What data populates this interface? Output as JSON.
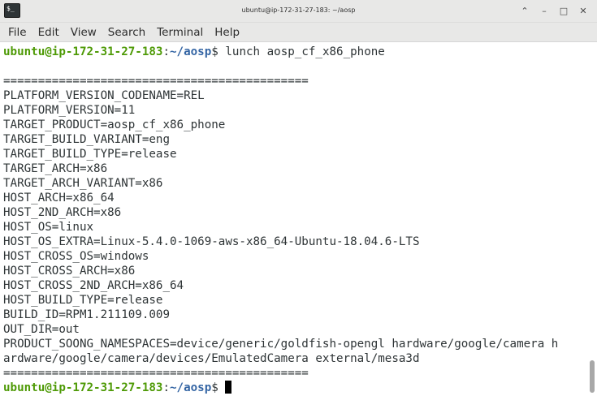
{
  "window": {
    "title": "ubuntu@ip-172-31-27-183: ~/aosp",
    "icon_glyph": "$_",
    "icons": {
      "app": "terminal-icon",
      "minimize": "chevron-up-icon",
      "minimize2": "minimize-icon",
      "maximize": "maximize-icon",
      "close": "close-icon"
    },
    "buttons": {
      "up": "⌃",
      "min": "–",
      "max": "□",
      "close": "✕"
    }
  },
  "menu": {
    "file": "File",
    "edit": "Edit",
    "view": "View",
    "search": "Search",
    "terminal": "Terminal",
    "help": "Help"
  },
  "terminal": {
    "prompt_user": "ubuntu@ip-172-31-27-183",
    "prompt_sep": ":",
    "prompt_path": "~/aosp",
    "prompt_symbol": "$ ",
    "command": "lunch aosp_cf_x86_phone",
    "output": [
      "",
      "============================================",
      "PLATFORM_VERSION_CODENAME=REL",
      "PLATFORM_VERSION=11",
      "TARGET_PRODUCT=aosp_cf_x86_phone",
      "TARGET_BUILD_VARIANT=eng",
      "TARGET_BUILD_TYPE=release",
      "TARGET_ARCH=x86",
      "TARGET_ARCH_VARIANT=x86",
      "HOST_ARCH=x86_64",
      "HOST_2ND_ARCH=x86",
      "HOST_OS=linux",
      "HOST_OS_EXTRA=Linux-5.4.0-1069-aws-x86_64-Ubuntu-18.04.6-LTS",
      "HOST_CROSS_OS=windows",
      "HOST_CROSS_ARCH=x86",
      "HOST_CROSS_2ND_ARCH=x86_64",
      "HOST_BUILD_TYPE=release",
      "BUILD_ID=RPM1.211109.009",
      "OUT_DIR=out",
      "PRODUCT_SOONG_NAMESPACES=device/generic/goldfish-opengl hardware/google/camera h",
      "ardware/google/camera/devices/EmulatedCamera external/mesa3d",
      "============================================"
    ]
  }
}
